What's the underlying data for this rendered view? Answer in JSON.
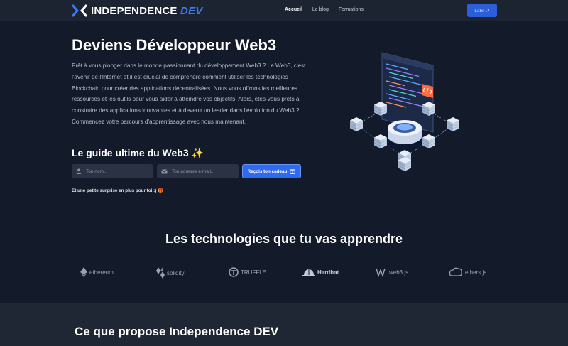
{
  "nav": {
    "brand_main": "INDEPENDENCE",
    "brand_accent": "DEV",
    "links": [
      {
        "label": "Accueil",
        "active": true
      },
      {
        "label": "Le blog",
        "active": false
      },
      {
        "label": "Formations",
        "active": false
      }
    ],
    "labs_label": "Labs ↗"
  },
  "hero": {
    "title": "Deviens Développeur Web3",
    "paragraph": "Prêt à vous plonger dans le monde passionnant du développement Web3 ? Le Web3, c'est l'avenir de l'Internet et il est crucial de comprendre comment utiliser les technologies Blockchain pour créer des applications décentralisées. Nous vous offrons les meilleures ressources et les outils pour vous aider à atteindre vos objectifs. Alors, êtes-vous prêts à construire des applications innovantes et à devenir un leader dans l'évolution du Web3 ? Commencez votre parcours d'apprentissage avec nous maintenant."
  },
  "guide": {
    "title": "Le guide ultime du Web3",
    "sparkle": "✨",
    "name_placeholder": "Ton nom...",
    "email_placeholder": "Ton adresse e-mail...",
    "submit_label": "Reçois ton cadeau",
    "surprise_text": "Et une petite surprise en plus pour toi :)",
    "gift_emoji": "🎁"
  },
  "technologies": {
    "title": "Les technologies que tu vas apprendre",
    "items": [
      {
        "label": "ethereum",
        "icon": "ethereum-icon"
      },
      {
        "label": "solidity",
        "icon": "solidity-icon"
      },
      {
        "label": "TRUFFLE",
        "icon": "truffle-icon"
      },
      {
        "label": "Hardhat",
        "icon": "hardhat-icon"
      },
      {
        "label": "web3.js",
        "icon": "web3js-icon"
      },
      {
        "label": "ethers.js",
        "icon": "ethersjs-icon"
      }
    ]
  },
  "section2": {
    "title": "Ce que propose Independence DEV"
  },
  "colors": {
    "background": "#131a2a",
    "nav_background": "#1c2331",
    "accent_blue": "#2f6bf0",
    "section_background": "#1f2634"
  }
}
